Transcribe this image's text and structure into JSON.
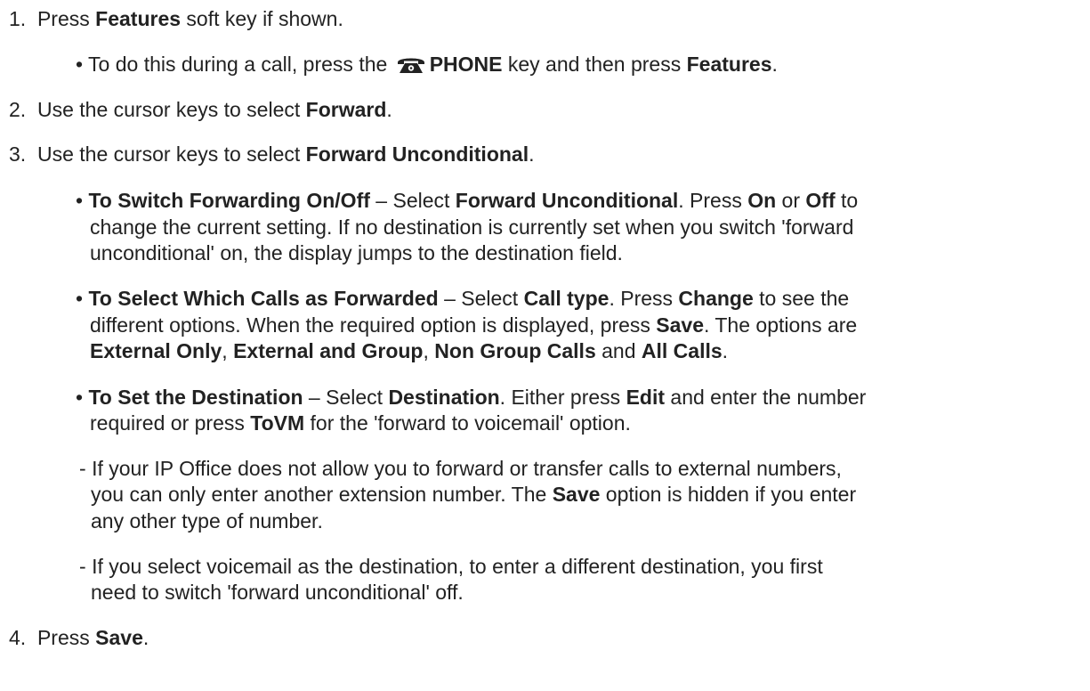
{
  "steps": [
    {
      "number": "1.",
      "parts": [
        {
          "t": "Press "
        },
        {
          "b": "Features"
        },
        {
          "t": " soft key if shown."
        }
      ],
      "bullets": [
        {
          "parts": [
            {
              "t": "To do this during a call, press the "
            },
            {
              "b": "PHONE"
            },
            {
              "t": " key and then press "
            },
            {
              "b": "Features"
            },
            {
              "t": "."
            }
          ]
        }
      ]
    },
    {
      "number": "2.",
      "parts": [
        {
          "t": "Use the cursor keys to select "
        },
        {
          "b": "Forward"
        },
        {
          "t": "."
        }
      ]
    },
    {
      "number": "3.",
      "parts": [
        {
          "t": "Use the cursor keys to select "
        },
        {
          "b": "Forward Unconditional"
        },
        {
          "t": "."
        }
      ],
      "bullets": [
        {
          "lines": [
            [
              {
                "b": "To Switch Forwarding On/Off"
              },
              {
                "t": " – Select "
              },
              {
                "b": "Forward Unconditional"
              },
              {
                "t": ". Press "
              },
              {
                "b": "On"
              },
              {
                "t": " or "
              },
              {
                "b": "Off"
              },
              {
                "t": " to"
              }
            ],
            [
              {
                "t": "change the current setting. If no destination is currently set when you switch 'forward"
              }
            ],
            [
              {
                "t": "unconditional' on, the display jumps to the destination field."
              }
            ]
          ]
        },
        {
          "lines": [
            [
              {
                "b": "To Select Which Calls as Forwarded"
              },
              {
                "t": " – Select "
              },
              {
                "b": "Call type"
              },
              {
                "t": ". Press "
              },
              {
                "b": "Change"
              },
              {
                "t": " to see the"
              }
            ],
            [
              {
                "t": "different options. When the required option is displayed, press "
              },
              {
                "b": "Save"
              },
              {
                "t": ". The options are"
              }
            ],
            [
              {
                "b": "External Only"
              },
              {
                "t": ", "
              },
              {
                "b": "External and Group"
              },
              {
                "t": ", "
              },
              {
                "b": "Non Group Calls"
              },
              {
                "t": " and "
              },
              {
                "b": "All Calls"
              },
              {
                "t": "."
              }
            ]
          ]
        },
        {
          "lines": [
            [
              {
                "b": "To Set the Destination"
              },
              {
                "t": " – Select "
              },
              {
                "b": "Destination"
              },
              {
                "t": ". Either press "
              },
              {
                "b": "Edit"
              },
              {
                "t": " and enter the number"
              }
            ],
            [
              {
                "t": "required or press "
              },
              {
                "b": "ToVM"
              },
              {
                "t": " for the 'forward to voicemail' option."
              }
            ]
          ]
        }
      ],
      "dashes": [
        {
          "lines": [
            [
              {
                "t": "If your IP Office does not allow you to forward or transfer calls to external numbers,"
              }
            ],
            [
              {
                "t": "you can only enter another extension number. The "
              },
              {
                "b": "Save"
              },
              {
                "t": " option is hidden if you enter"
              }
            ],
            [
              {
                "t": "any other type of number."
              }
            ]
          ]
        },
        {
          "lines": [
            [
              {
                "t": "If you select voicemail as the destination, to enter a different destination, you first"
              }
            ],
            [
              {
                "t": "need to switch 'forward unconditional' off."
              }
            ]
          ]
        }
      ]
    },
    {
      "number": "4.",
      "parts": [
        {
          "t": "Press "
        },
        {
          "b": "Save"
        },
        {
          "t": "."
        }
      ]
    }
  ],
  "markers": {
    "bullet": "•",
    "dash": "-"
  },
  "icons": {
    "phone_key": "telephone-handset-icon"
  },
  "colors": {
    "text": "#222222"
  }
}
